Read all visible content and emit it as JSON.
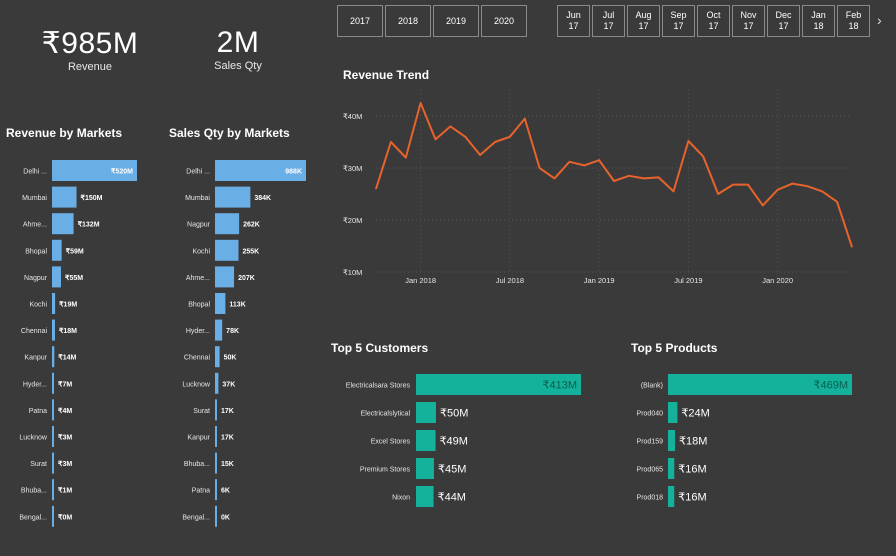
{
  "kpis": {
    "revenue_value": "₹985M",
    "revenue_label": "Revenue",
    "qty_value": "2M",
    "qty_label": "Sales Qty"
  },
  "year_slicer": [
    "2017",
    "2018",
    "2019",
    "2020"
  ],
  "month_slicer": [
    {
      "m": "Jun",
      "y": "17"
    },
    {
      "m": "Jul",
      "y": "17"
    },
    {
      "m": "Aug",
      "y": "17"
    },
    {
      "m": "Sep",
      "y": "17"
    },
    {
      "m": "Oct",
      "y": "17"
    },
    {
      "m": "Nov",
      "y": "17"
    },
    {
      "m": "Dec",
      "y": "17"
    },
    {
      "m": "Jan",
      "y": "18"
    },
    {
      "m": "Feb",
      "y": "18"
    }
  ],
  "colors": {
    "market_bar": "#6aaee6",
    "top5_bar": "#14b19b",
    "trend_line": "#e8632c",
    "background": "#3a3a3a"
  },
  "chart_data": [
    {
      "id": "revenue_by_markets",
      "type": "bar",
      "orientation": "horizontal",
      "title": "Revenue by Markets",
      "categories": [
        "Delhi ...",
        "Mumbai",
        "Ahme...",
        "Bhopal",
        "Nagpur",
        "Kochi",
        "Chennai",
        "Kanpur",
        "Hyder...",
        "Patna",
        "Lucknow",
        "Surat",
        "Bhuba...",
        "Bengal..."
      ],
      "values": [
        520,
        150,
        132,
        59,
        55,
        19,
        18,
        14,
        7,
        4,
        3,
        3,
        1,
        0
      ],
      "labels": [
        "₹520M",
        "₹150M",
        "₹132M",
        "₹59M",
        "₹55M",
        "₹19M",
        "₹18M",
        "₹14M",
        "₹7M",
        "₹4M",
        "₹3M",
        "₹3M",
        "₹1M",
        "₹0M"
      ],
      "unit": "M"
    },
    {
      "id": "sales_qty_by_markets",
      "type": "bar",
      "orientation": "horizontal",
      "title": "Sales Qty by Markets",
      "categories": [
        "Delhi ...",
        "Mumbai",
        "Nagpur",
        "Kochi",
        "Ahme...",
        "Bhopal",
        "Hyder...",
        "Chennai",
        "Lucknow",
        "Surat",
        "Kanpur",
        "Bhuba...",
        "Patna",
        "Bengal..."
      ],
      "values": [
        988,
        384,
        262,
        255,
        207,
        113,
        78,
        50,
        37,
        17,
        17,
        15,
        6,
        0
      ],
      "labels": [
        "988K",
        "384K",
        "262K",
        "255K",
        "207K",
        "113K",
        "78K",
        "50K",
        "37K",
        "17K",
        "17K",
        "15K",
        "6K",
        "0K"
      ],
      "unit": "K"
    },
    {
      "id": "revenue_trend",
      "type": "line",
      "title": "Revenue Trend",
      "x_ticks": [
        "Jan 2018",
        "Jul 2018",
        "Jan 2019",
        "Jul 2019",
        "Jan 2020"
      ],
      "y_ticks": [
        "₹10M",
        "₹20M",
        "₹30M",
        "₹40M"
      ],
      "ylim": [
        10,
        45
      ],
      "x": [
        "2017-10",
        "2017-11",
        "2017-12",
        "2018-01",
        "2018-02",
        "2018-03",
        "2018-04",
        "2018-05",
        "2018-06",
        "2018-07",
        "2018-08",
        "2018-09",
        "2018-10",
        "2018-11",
        "2018-12",
        "2019-01",
        "2019-02",
        "2019-03",
        "2019-04",
        "2019-05",
        "2019-06",
        "2019-07",
        "2019-08",
        "2019-09",
        "2019-10",
        "2019-11",
        "2019-12",
        "2020-01",
        "2020-02",
        "2020-03",
        "2020-04",
        "2020-05",
        "2020-06"
      ],
      "values": [
        26,
        35,
        32,
        42.5,
        35.5,
        38,
        36,
        32.5,
        35,
        36,
        39.5,
        30,
        28,
        31.2,
        30.5,
        31.5,
        27.5,
        28.5,
        28,
        28.2,
        25.5,
        35.2,
        32.2,
        25,
        26.8,
        26.8,
        22.8,
        25.8,
        27,
        26.5,
        25.5,
        23.5,
        14.8
      ]
    },
    {
      "id": "top5_customers",
      "type": "bar",
      "orientation": "horizontal",
      "title": "Top 5 Customers",
      "categories": [
        "Electricalsara Stores",
        "Electricalslytical",
        "Excel Stores",
        "Premium Stores",
        "Nixon"
      ],
      "values": [
        413,
        50,
        49,
        45,
        44
      ],
      "labels": [
        "₹413M",
        "₹50M",
        "₹49M",
        "₹45M",
        "₹44M"
      ],
      "unit": "M"
    },
    {
      "id": "top5_products",
      "type": "bar",
      "orientation": "horizontal",
      "title": "Top 5 Products",
      "categories": [
        "(Blank)",
        "Prod040",
        "Prod159",
        "Prod065",
        "Prod018"
      ],
      "values": [
        469,
        24,
        18,
        16,
        16
      ],
      "labels": [
        "₹469M",
        "₹24M",
        "₹18M",
        "₹16M",
        "₹16M"
      ],
      "unit": "M"
    }
  ]
}
